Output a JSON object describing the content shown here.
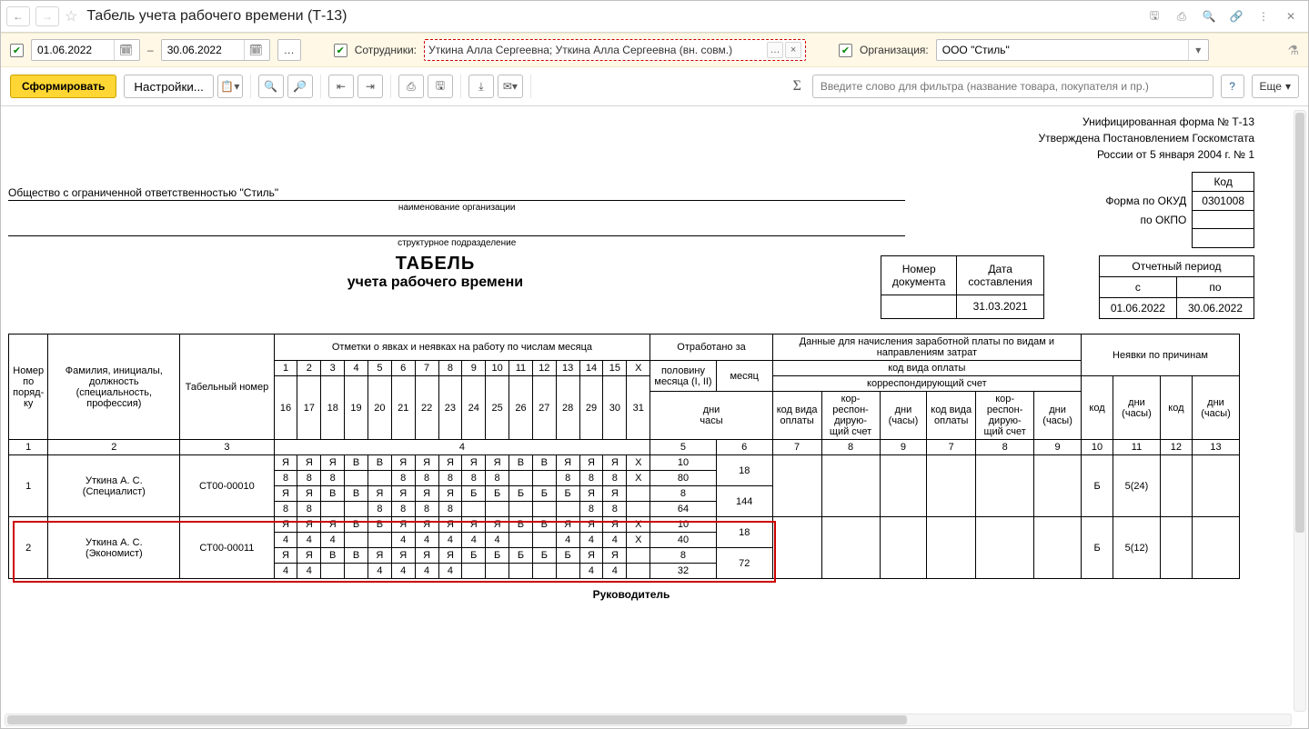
{
  "title": "Табель учета рабочего времени (Т-13)",
  "filter": {
    "date_from": "01.06.2022",
    "date_to": "30.06.2022",
    "separator": "–",
    "employees_label": "Сотрудники:",
    "employees_value": "Уткина Алла Сергеевна; Уткина Алла Сергеевна (вн. совм.)",
    "org_label": "Организация:",
    "org_value": "ООО \"Стиль\""
  },
  "toolbar": {
    "form_btn": "Сформировать",
    "settings_btn": "Настройки...",
    "filter_placeholder": "Введите слово для фильтра (название товара, покупателя и пр.)",
    "more_btn": "Еще"
  },
  "doc": {
    "form_header": [
      "Унифицированная форма № Т-13",
      "Утверждена Постановлением Госкомстата",
      "России от 5 января 2004 г. № 1"
    ],
    "code_label": "Код",
    "okud_label": "Форма по ОКУД",
    "okud_code": "0301008",
    "okpo_label": "по ОКПО",
    "okpo_code": "",
    "org_name": "Общество с ограниченной ответственностью \"Стиль\"",
    "org_caption": "наименование организации",
    "dept_caption": "структурное подразделение",
    "title_main": "ТАБЕЛЬ",
    "title_sub": "учета  рабочего времени",
    "meta1": {
      "col1_l1": "Номер",
      "col1_l2": "документа",
      "col2_l1": "Дата",
      "col2_l2": "составления",
      "num": "",
      "date": "31.03.2021"
    },
    "meta2": {
      "head": "Отчетный период",
      "from_l": "с",
      "to_l": "по",
      "from": "01.06.2022",
      "to": "30.06.2022"
    },
    "footer": "Руководитель"
  },
  "headers": {
    "num": "Номер по поряд-ку",
    "fio": "Фамилия, инициалы, должность (специальность, профессия)",
    "tabnum": "Табельный номер",
    "marks": "Отметки о явках и неявках на работу по числам месяца",
    "worked": "Отработано за",
    "half": "половину месяца (I, II)",
    "month": "месяц",
    "days": "дни",
    "hours": "часы",
    "pay": "Данные для начисления заработной платы по видам и направлениям затрат",
    "pay_kind": "код вида оплаты",
    "corr": "корреспондирующий счет",
    "pay_code": "код вида оплаты",
    "pay_corr": "кор-респон-дирую-щий счет",
    "pay_days": "дни (часы)",
    "abs": "Неявки по причинам",
    "abs_code": "код",
    "abs_days": "дни (часы)",
    "colnums": [
      "1",
      "2",
      "3",
      "4",
      "5",
      "6",
      "7",
      "8",
      "9",
      "10",
      "11",
      "12",
      "13"
    ]
  },
  "daynums_top": [
    "1",
    "2",
    "3",
    "4",
    "5",
    "6",
    "7",
    "8",
    "9",
    "10",
    "11",
    "12",
    "13",
    "14",
    "15",
    "X"
  ],
  "daynums_bot": [
    "16",
    "17",
    "18",
    "19",
    "20",
    "21",
    "22",
    "23",
    "24",
    "25",
    "26",
    "27",
    "28",
    "29",
    "30",
    "31"
  ],
  "rows": [
    {
      "num": "1",
      "fio": "Уткина А. С.",
      "post": "(Специалист)",
      "tabnum": "СТ00-00010",
      "line1": [
        "Я",
        "Я",
        "Я",
        "В",
        "В",
        "Я",
        "Я",
        "Я",
        "Я",
        "Я",
        "В",
        "В",
        "Я",
        "Я",
        "Я",
        "X"
      ],
      "line1h": [
        "8",
        "8",
        "8",
        "",
        "",
        "8",
        "8",
        "8",
        "8",
        "8",
        "",
        "",
        "8",
        "8",
        "8",
        "X"
      ],
      "line2": [
        "Я",
        "Я",
        "В",
        "В",
        "Я",
        "Я",
        "Я",
        "Я",
        "Б",
        "Б",
        "Б",
        "Б",
        "Б",
        "Я",
        "Я",
        ""
      ],
      "line2h": [
        "8",
        "8",
        "",
        "",
        "8",
        "8",
        "8",
        "8",
        "",
        "",
        "",
        "",
        "",
        "8",
        "8",
        ""
      ],
      "half": [
        "10",
        "80",
        "8",
        "64"
      ],
      "month_days": "18",
      "month_hours": "144",
      "abs_code": "Б",
      "abs_days": "5(24)"
    },
    {
      "num": "2",
      "fio": "Уткина А. С.",
      "post": "(Экономист)",
      "tabnum": "СТ00-00011",
      "line1": [
        "Я",
        "Я",
        "Я",
        "В",
        "В",
        "Я",
        "Я",
        "Я",
        "Я",
        "Я",
        "В",
        "В",
        "Я",
        "Я",
        "Я",
        "X"
      ],
      "line1h": [
        "4",
        "4",
        "4",
        "",
        "",
        "4",
        "4",
        "4",
        "4",
        "4",
        "",
        "",
        "4",
        "4",
        "4",
        "X"
      ],
      "line2": [
        "Я",
        "Я",
        "В",
        "В",
        "Я",
        "Я",
        "Я",
        "Я",
        "Б",
        "Б",
        "Б",
        "Б",
        "Б",
        "Я",
        "Я",
        ""
      ],
      "line2h": [
        "4",
        "4",
        "",
        "",
        "4",
        "4",
        "4",
        "4",
        "",
        "",
        "",
        "",
        "",
        "4",
        "4",
        ""
      ],
      "half": [
        "10",
        "40",
        "8",
        "32"
      ],
      "month_days": "18",
      "month_hours": "72",
      "abs_code": "Б",
      "abs_days": "5(12)"
    }
  ]
}
